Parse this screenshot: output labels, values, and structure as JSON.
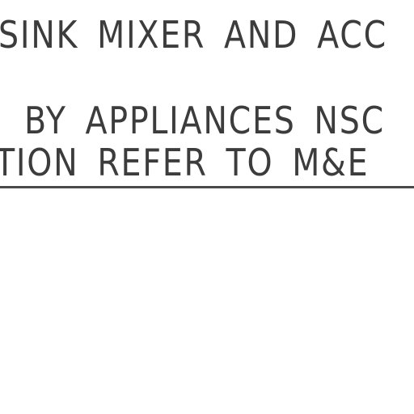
{
  "drawing_note": {
    "lines": [
      "SINK MIXER AND ACC",
      "BY APPLIANCES NSC",
      "TION REFER TO M&E"
    ]
  }
}
